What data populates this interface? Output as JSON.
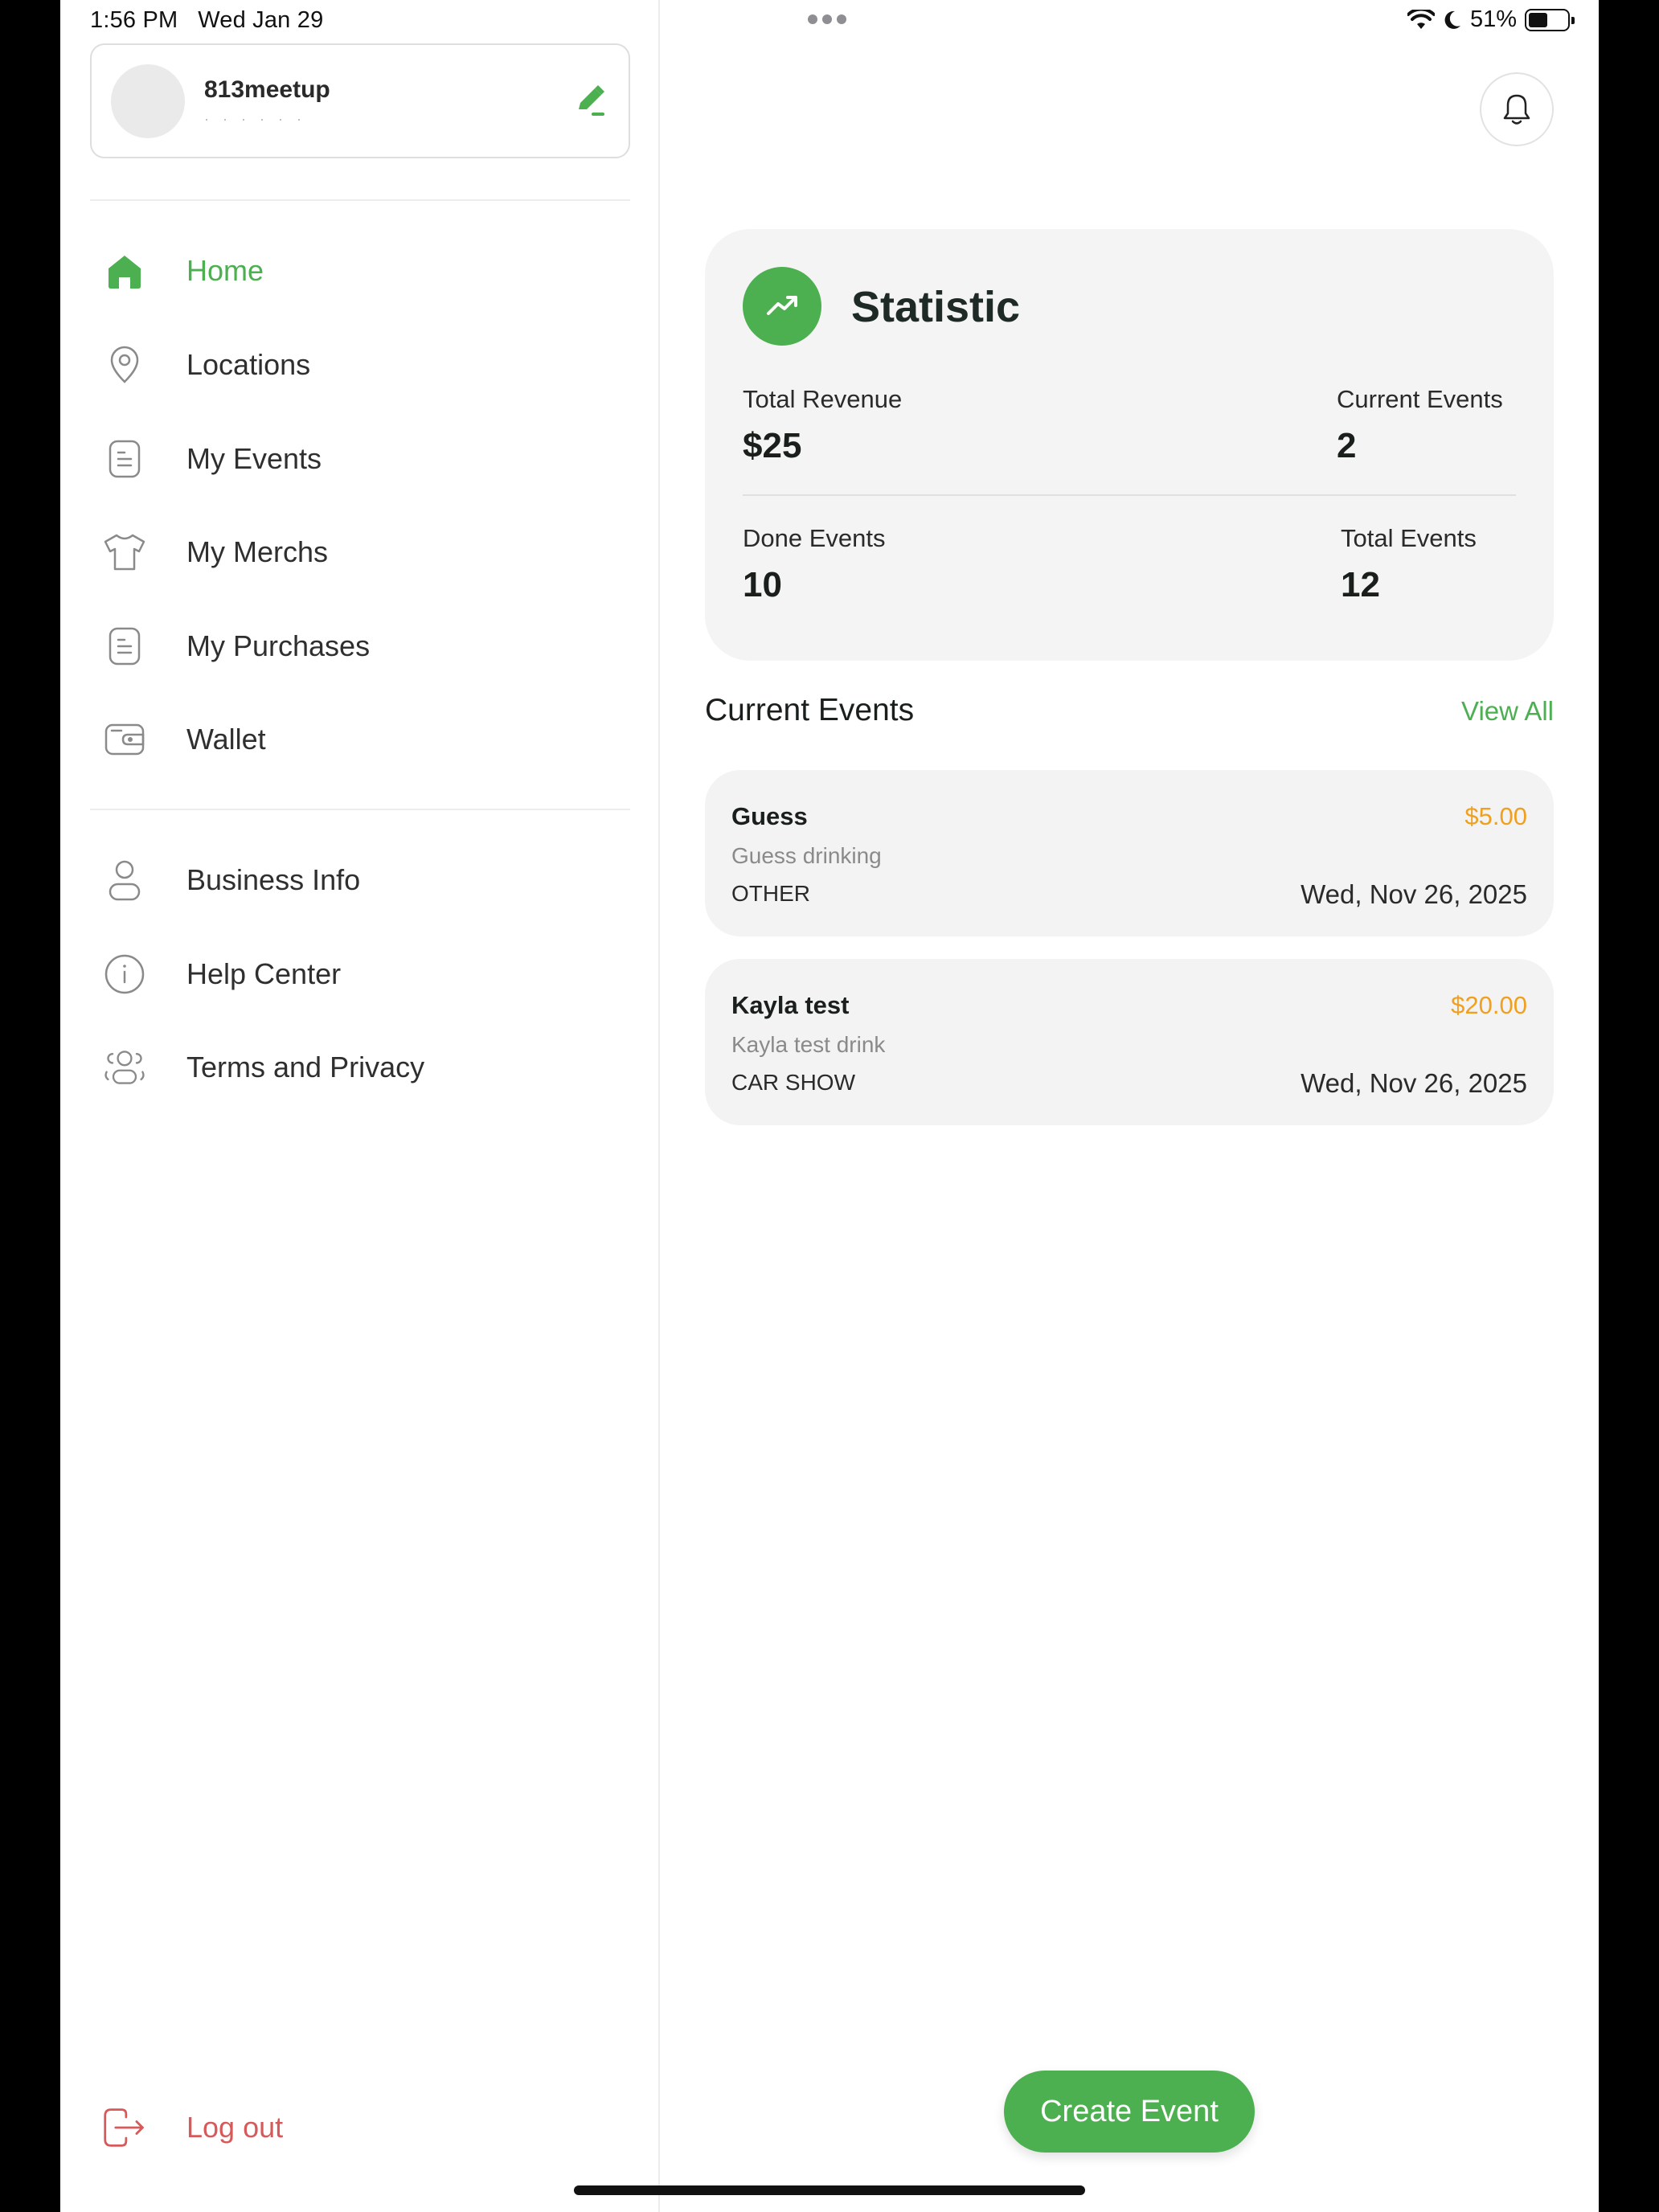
{
  "status_bar": {
    "time": "1:56 PM",
    "date": "Wed Jan 29",
    "battery": "51%",
    "battery_level": 0.51
  },
  "profile": {
    "name": "813meetup",
    "subtitle": "· · · · · ·"
  },
  "nav": {
    "home": "Home",
    "locations": "Locations",
    "my_events": "My Events",
    "my_merchs": "My Merchs",
    "my_purchases": "My Purchases",
    "wallet": "Wallet",
    "business_info": "Business Info",
    "help_center": "Help Center",
    "terms": "Terms and Privacy",
    "logout": "Log out"
  },
  "statistic": {
    "title": "Statistic",
    "total_revenue_label": "Total Revenue",
    "total_revenue": "$25",
    "current_events_label": "Current Events",
    "current_events": "2",
    "done_events_label": "Done Events",
    "done_events": "10",
    "total_events_label": "Total Events",
    "total_events": "12"
  },
  "current_events": {
    "title": "Current Events",
    "view_all": "View All",
    "items": [
      {
        "title": "Guess",
        "price": "$5.00",
        "description": "Guess drinking",
        "category": "OTHER",
        "date": "Wed, Nov 26, 2025"
      },
      {
        "title": "Kayla test",
        "price": "$20.00",
        "description": "Kayla test drink",
        "category": "CAR SHOW",
        "date": "Wed, Nov 26, 2025"
      }
    ]
  },
  "create_event": "Create Event",
  "colors": {
    "accent": "#4caf50",
    "price": "#f0a020",
    "logout": "#d65a5a"
  }
}
